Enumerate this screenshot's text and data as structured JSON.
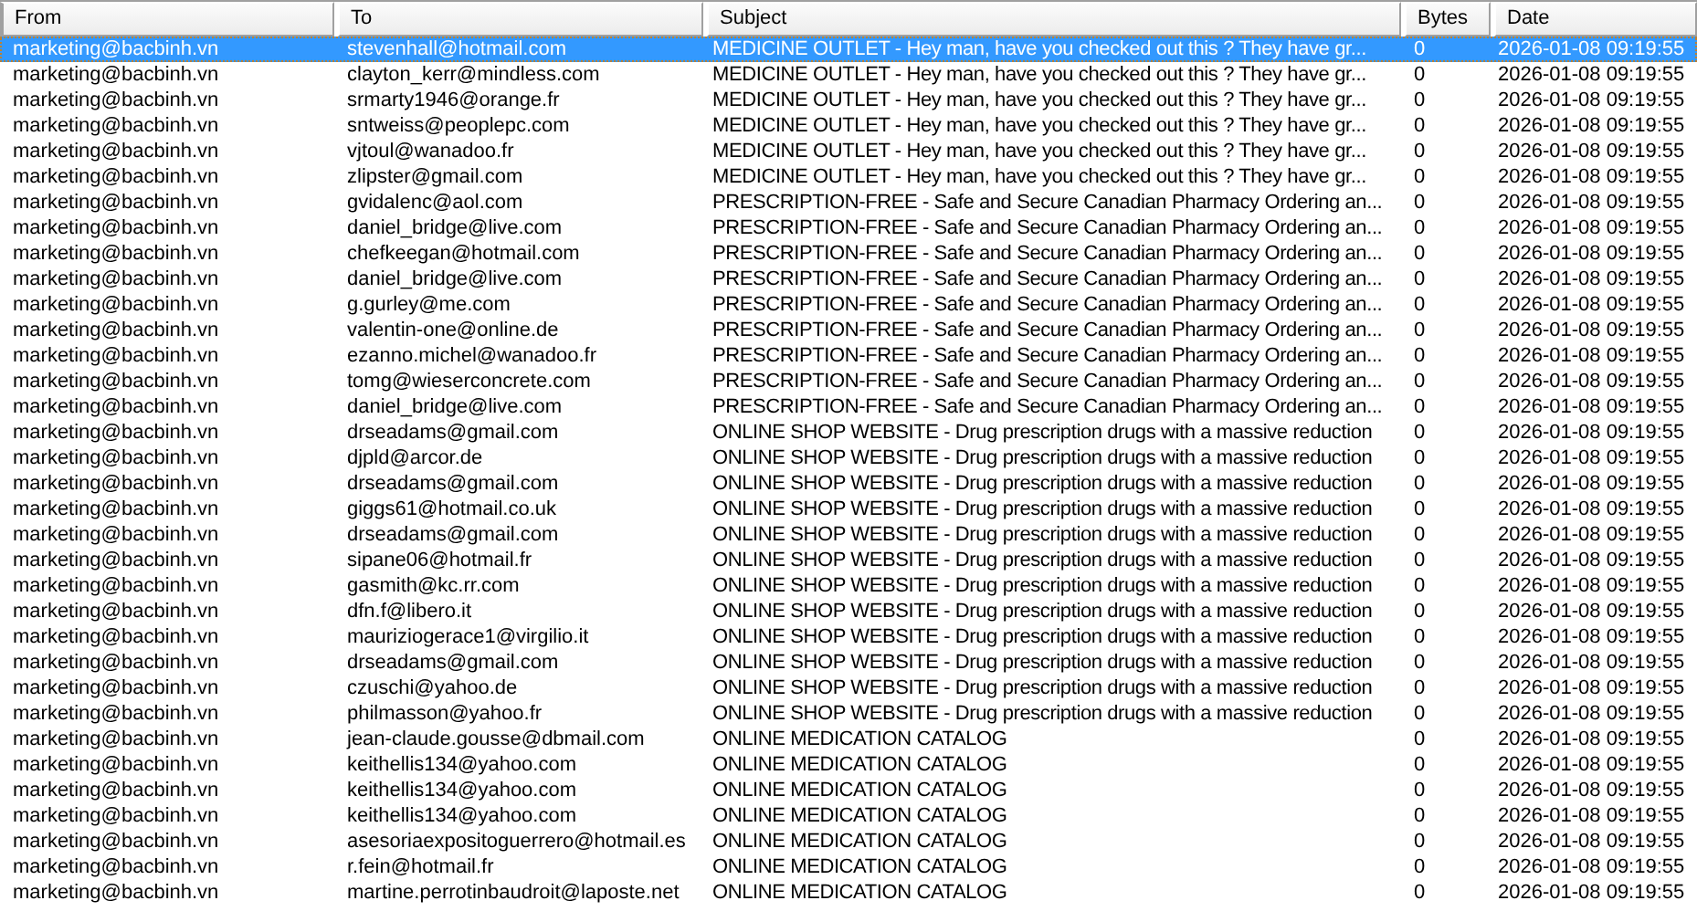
{
  "table": {
    "columns": [
      "From",
      "To",
      "Subject",
      "Bytes",
      "Date"
    ],
    "rows": [
      {
        "from": "marketing@bacbinh.vn",
        "to": "stevenhall@hotmail.com",
        "subject": "MEDICINE OUTLET - Hey man, have you checked out this ? They have gr...",
        "bytes": "0",
        "date": "2026-01-08 09:19:55",
        "selected": true
      },
      {
        "from": "marketing@bacbinh.vn",
        "to": "clayton_kerr@mindless.com",
        "subject": "MEDICINE OUTLET - Hey man, have you checked out this ? They have gr...",
        "bytes": "0",
        "date": "2026-01-08 09:19:55",
        "selected": false
      },
      {
        "from": "marketing@bacbinh.vn",
        "to": "srmarty1946@orange.fr",
        "subject": "MEDICINE OUTLET - Hey man, have you checked out this ? They have gr...",
        "bytes": "0",
        "date": "2026-01-08 09:19:55",
        "selected": false
      },
      {
        "from": "marketing@bacbinh.vn",
        "to": "sntweiss@peoplepc.com",
        "subject": "MEDICINE OUTLET - Hey man, have you checked out this ? They have gr...",
        "bytes": "0",
        "date": "2026-01-08 09:19:55",
        "selected": false
      },
      {
        "from": "marketing@bacbinh.vn",
        "to": "vjtoul@wanadoo.fr",
        "subject": "MEDICINE OUTLET - Hey man, have you checked out this ? They have gr...",
        "bytes": "0",
        "date": "2026-01-08 09:19:55",
        "selected": false
      },
      {
        "from": "marketing@bacbinh.vn",
        "to": "zlipster@gmail.com",
        "subject": "MEDICINE OUTLET - Hey man, have you checked out this ? They have gr...",
        "bytes": "0",
        "date": "2026-01-08 09:19:55",
        "selected": false
      },
      {
        "from": "marketing@bacbinh.vn",
        "to": "gvidalenc@aol.com",
        "subject": "PRESCRIPTION-FREE - Safe and Secure Canadian Pharmacy Ordering an...",
        "bytes": "0",
        "date": "2026-01-08 09:19:55",
        "selected": false
      },
      {
        "from": "marketing@bacbinh.vn",
        "to": "daniel_bridge@live.com",
        "subject": "PRESCRIPTION-FREE - Safe and Secure Canadian Pharmacy Ordering an...",
        "bytes": "0",
        "date": "2026-01-08 09:19:55",
        "selected": false
      },
      {
        "from": "marketing@bacbinh.vn",
        "to": "chefkeegan@hotmail.com",
        "subject": "PRESCRIPTION-FREE - Safe and Secure Canadian Pharmacy Ordering an...",
        "bytes": "0",
        "date": "2026-01-08 09:19:55",
        "selected": false
      },
      {
        "from": "marketing@bacbinh.vn",
        "to": "daniel_bridge@live.com",
        "subject": "PRESCRIPTION-FREE - Safe and Secure Canadian Pharmacy Ordering an...",
        "bytes": "0",
        "date": "2026-01-08 09:19:55",
        "selected": false
      },
      {
        "from": "marketing@bacbinh.vn",
        "to": "g.gurley@me.com",
        "subject": "PRESCRIPTION-FREE - Safe and Secure Canadian Pharmacy Ordering an...",
        "bytes": "0",
        "date": "2026-01-08 09:19:55",
        "selected": false
      },
      {
        "from": "marketing@bacbinh.vn",
        "to": "valentin-one@online.de",
        "subject": "PRESCRIPTION-FREE - Safe and Secure Canadian Pharmacy Ordering an...",
        "bytes": "0",
        "date": "2026-01-08 09:19:55",
        "selected": false
      },
      {
        "from": "marketing@bacbinh.vn",
        "to": "ezanno.michel@wanadoo.fr",
        "subject": "PRESCRIPTION-FREE - Safe and Secure Canadian Pharmacy Ordering an...",
        "bytes": "0",
        "date": "2026-01-08 09:19:55",
        "selected": false
      },
      {
        "from": "marketing@bacbinh.vn",
        "to": "tomg@wieserconcrete.com",
        "subject": "PRESCRIPTION-FREE - Safe and Secure Canadian Pharmacy Ordering an...",
        "bytes": "0",
        "date": "2026-01-08 09:19:55",
        "selected": false
      },
      {
        "from": "marketing@bacbinh.vn",
        "to": "daniel_bridge@live.com",
        "subject": "PRESCRIPTION-FREE - Safe and Secure Canadian Pharmacy Ordering an...",
        "bytes": "0",
        "date": "2026-01-08 09:19:55",
        "selected": false
      },
      {
        "from": "marketing@bacbinh.vn",
        "to": "drseadams@gmail.com",
        "subject": "ONLINE SHOP WEBSITE - Drug prescription drugs with a massive reduction",
        "bytes": "0",
        "date": "2026-01-08 09:19:55",
        "selected": false
      },
      {
        "from": "marketing@bacbinh.vn",
        "to": "djpld@arcor.de",
        "subject": "ONLINE SHOP WEBSITE - Drug prescription drugs with a massive reduction",
        "bytes": "0",
        "date": "2026-01-08 09:19:55",
        "selected": false
      },
      {
        "from": "marketing@bacbinh.vn",
        "to": "drseadams@gmail.com",
        "subject": "ONLINE SHOP WEBSITE - Drug prescription drugs with a massive reduction",
        "bytes": "0",
        "date": "2026-01-08 09:19:55",
        "selected": false
      },
      {
        "from": "marketing@bacbinh.vn",
        "to": "giggs61@hotmail.co.uk",
        "subject": "ONLINE SHOP WEBSITE - Drug prescription drugs with a massive reduction",
        "bytes": "0",
        "date": "2026-01-08 09:19:55",
        "selected": false
      },
      {
        "from": "marketing@bacbinh.vn",
        "to": "drseadams@gmail.com",
        "subject": "ONLINE SHOP WEBSITE - Drug prescription drugs with a massive reduction",
        "bytes": "0",
        "date": "2026-01-08 09:19:55",
        "selected": false
      },
      {
        "from": "marketing@bacbinh.vn",
        "to": "sipane06@hotmail.fr",
        "subject": "ONLINE SHOP WEBSITE - Drug prescription drugs with a massive reduction",
        "bytes": "0",
        "date": "2026-01-08 09:19:55",
        "selected": false
      },
      {
        "from": "marketing@bacbinh.vn",
        "to": "gasmith@kc.rr.com",
        "subject": "ONLINE SHOP WEBSITE - Drug prescription drugs with a massive reduction",
        "bytes": "0",
        "date": "2026-01-08 09:19:55",
        "selected": false
      },
      {
        "from": "marketing@bacbinh.vn",
        "to": "dfn.f@libero.it",
        "subject": "ONLINE SHOP WEBSITE - Drug prescription drugs with a massive reduction",
        "bytes": "0",
        "date": "2026-01-08 09:19:55",
        "selected": false
      },
      {
        "from": "marketing@bacbinh.vn",
        "to": "mauriziogerace1@virgilio.it",
        "subject": "ONLINE SHOP WEBSITE - Drug prescription drugs with a massive reduction",
        "bytes": "0",
        "date": "2026-01-08 09:19:55",
        "selected": false
      },
      {
        "from": "marketing@bacbinh.vn",
        "to": "drseadams@gmail.com",
        "subject": "ONLINE SHOP WEBSITE - Drug prescription drugs with a massive reduction",
        "bytes": "0",
        "date": "2026-01-08 09:19:55",
        "selected": false
      },
      {
        "from": "marketing@bacbinh.vn",
        "to": "czuschi@yahoo.de",
        "subject": "ONLINE SHOP WEBSITE - Drug prescription drugs with a massive reduction",
        "bytes": "0",
        "date": "2026-01-08 09:19:55",
        "selected": false
      },
      {
        "from": "marketing@bacbinh.vn",
        "to": "philmasson@yahoo.fr",
        "subject": "ONLINE SHOP WEBSITE - Drug prescription drugs with a massive reduction",
        "bytes": "0",
        "date": "2026-01-08 09:19:55",
        "selected": false
      },
      {
        "from": "marketing@bacbinh.vn",
        "to": "jean-claude.gousse@dbmail.com",
        "subject": "ONLINE MEDICATION CATALOG",
        "bytes": "0",
        "date": "2026-01-08 09:19:55",
        "selected": false
      },
      {
        "from": "marketing@bacbinh.vn",
        "to": "keithellis134@yahoo.com",
        "subject": "ONLINE MEDICATION CATALOG",
        "bytes": "0",
        "date": "2026-01-08 09:19:55",
        "selected": false
      },
      {
        "from": "marketing@bacbinh.vn",
        "to": "keithellis134@yahoo.com",
        "subject": "ONLINE MEDICATION CATALOG",
        "bytes": "0",
        "date": "2026-01-08 09:19:55",
        "selected": false
      },
      {
        "from": "marketing@bacbinh.vn",
        "to": "keithellis134@yahoo.com",
        "subject": "ONLINE MEDICATION CATALOG",
        "bytes": "0",
        "date": "2026-01-08 09:19:55",
        "selected": false
      },
      {
        "from": "marketing@bacbinh.vn",
        "to": "asesoriaexpositoguerrero@hotmail.es",
        "subject": "ONLINE MEDICATION CATALOG",
        "bytes": "0",
        "date": "2026-01-08 09:19:55",
        "selected": false
      },
      {
        "from": "marketing@bacbinh.vn",
        "to": "r.fein@hotmail.fr",
        "subject": "ONLINE MEDICATION CATALOG",
        "bytes": "0",
        "date": "2026-01-08 09:19:55",
        "selected": false
      },
      {
        "from": "marketing@bacbinh.vn",
        "to": "martine.perrotinbaudroit@laposte.net",
        "subject": "ONLINE MEDICATION CATALOG",
        "bytes": "0",
        "date": "2026-01-08 09:19:55",
        "selected": false
      }
    ]
  }
}
